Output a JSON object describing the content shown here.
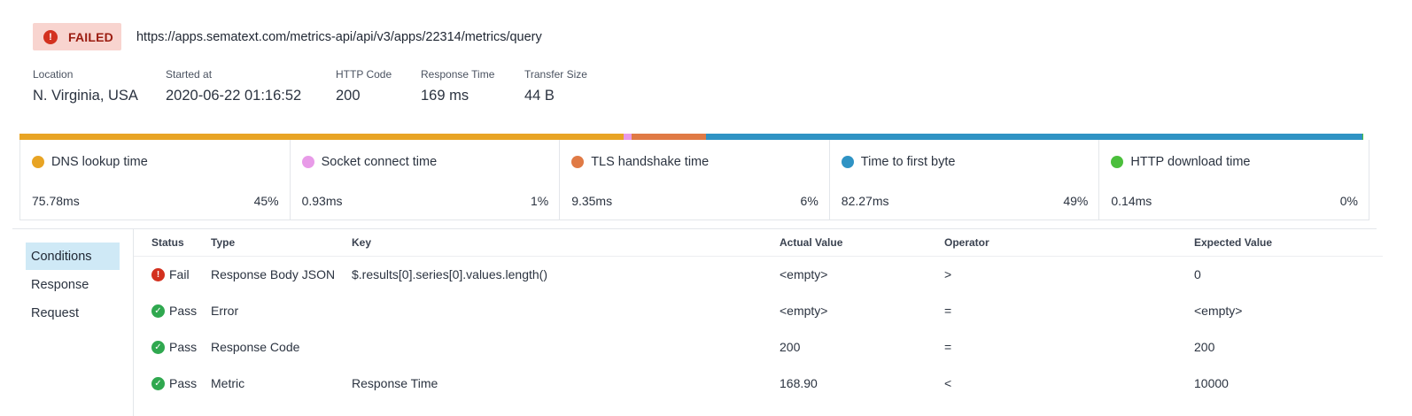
{
  "header": {
    "status_label": "FAILED",
    "url": "https://apps.sematext.com/metrics-api/api/v3/apps/22314/metrics/query"
  },
  "meta": [
    {
      "label": "Location",
      "value": "N. Virginia, USA"
    },
    {
      "label": "Started at",
      "value": "2020-06-22 01:16:52"
    },
    {
      "label": "HTTP Code",
      "value": "200"
    },
    {
      "label": "Response Time",
      "value": "169 ms"
    },
    {
      "label": "Transfer Size",
      "value": "44 B"
    }
  ],
  "timing_bar": [
    {
      "name": "DNS lookup time",
      "fraction": 0.4489,
      "color": "#e8a424"
    },
    {
      "name": "Socket connect time",
      "fraction": 0.0055,
      "color": "#e89be8"
    },
    {
      "name": "TLS handshake time",
      "fraction": 0.0554,
      "color": "#e07a45"
    },
    {
      "name": "Time to first byte",
      "fraction": 0.4874,
      "color": "#2f93c4"
    },
    {
      "name": "HTTP download time",
      "fraction": 0.0008,
      "color": "#4bbf3c"
    }
  ],
  "phases": [
    {
      "name": "DNS lookup time",
      "ms": "75.78ms",
      "pct": "45%",
      "color": "#e8a424"
    },
    {
      "name": "Socket connect time",
      "ms": "0.93ms",
      "pct": "1%",
      "color": "#e89be8"
    },
    {
      "name": "TLS handshake time",
      "ms": "9.35ms",
      "pct": "6%",
      "color": "#e07a45"
    },
    {
      "name": "Time to first byte",
      "ms": "82.27ms",
      "pct": "49%",
      "color": "#2f93c4"
    },
    {
      "name": "HTTP download time",
      "ms": "0.14ms",
      "pct": "0%",
      "color": "#4bbf3c"
    }
  ],
  "nav": {
    "items": [
      "Conditions",
      "Response",
      "Request"
    ],
    "active": "Conditions"
  },
  "conditions": {
    "columns": [
      "Status",
      "Type",
      "Key",
      "Actual Value",
      "Operator",
      "Expected Value"
    ],
    "rows": [
      {
        "status": "Fail",
        "icon": "error-icon",
        "type": "Response Body JSON",
        "key": "$.results[0].series[0].values.length()",
        "actual": "<empty>",
        "operator": ">",
        "expected": "0"
      },
      {
        "status": "Pass",
        "icon": "check-icon",
        "type": "Error",
        "key": "",
        "actual": "<empty>",
        "operator": "=",
        "expected": "<empty>"
      },
      {
        "status": "Pass",
        "icon": "check-icon",
        "type": "Response Code",
        "key": "",
        "actual": "200",
        "operator": "=",
        "expected": "200"
      },
      {
        "status": "Pass",
        "icon": "check-icon",
        "type": "Metric",
        "key": "Response Time",
        "actual": "168.90",
        "operator": "<",
        "expected": "10000"
      }
    ]
  }
}
